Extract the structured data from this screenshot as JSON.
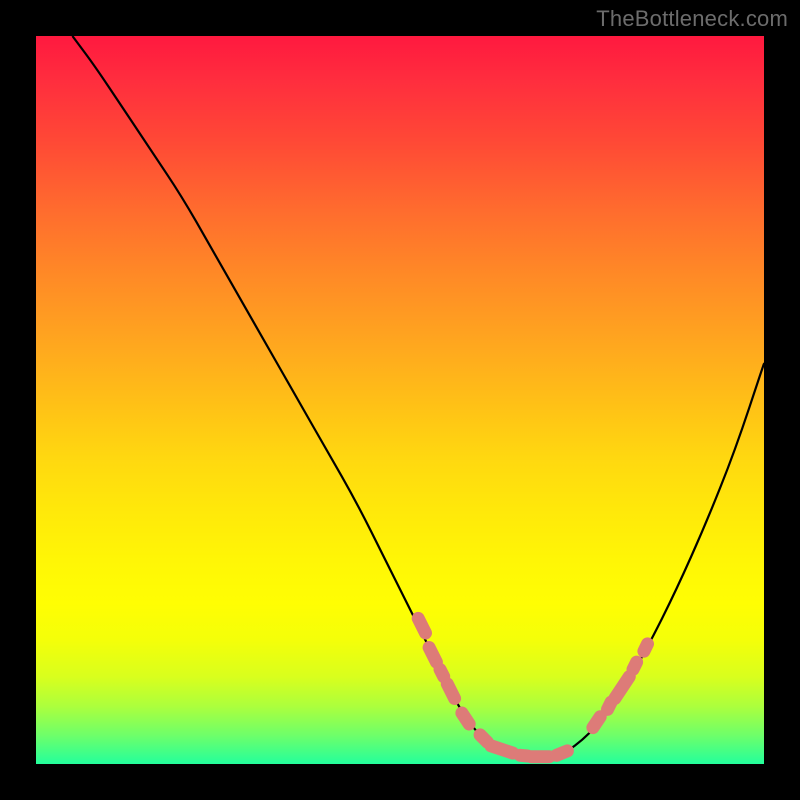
{
  "watermark": "TheBottleneck.com",
  "colors": {
    "background": "#000000",
    "gradient_top": "#ff193f",
    "gradient_bottom": "#23ff9c",
    "curve": "#000000",
    "markers": "#dd7b78",
    "watermark_text": "#6c6c6c"
  },
  "chart_data": {
    "type": "line",
    "title": "",
    "xlabel": "",
    "ylabel": "",
    "xlim": [
      0,
      100
    ],
    "ylim": [
      0,
      100
    ],
    "grid": false,
    "series": [
      {
        "name": "bottleneck_curve",
        "color": "#000000",
        "x": [
          5,
          8,
          12,
          16,
          20,
          24,
          28,
          32,
          36,
          40,
          44,
          48,
          52,
          56,
          58,
          60,
          62,
          64,
          68,
          72,
          76,
          80,
          84,
          88,
          92,
          96,
          100
        ],
        "y": [
          100,
          96,
          90,
          84,
          78,
          71,
          64,
          57,
          50,
          43,
          36,
          28,
          20,
          12,
          8,
          5,
          3,
          2,
          1,
          1,
          4,
          9,
          16,
          24,
          33,
          43,
          55
        ]
      }
    ],
    "markers": [
      {
        "name": "highlighted_segments",
        "color": "#dd7b78",
        "shape": "rounded-bar",
        "segments": [
          {
            "x0": 52.5,
            "y0": 20.0,
            "x1": 53.5,
            "y1": 18.0
          },
          {
            "x0": 54.0,
            "y0": 16.0,
            "x1": 55.0,
            "y1": 14.0
          },
          {
            "x0": 55.5,
            "y0": 13.0,
            "x1": 56.0,
            "y1": 12.0
          },
          {
            "x0": 56.5,
            "y0": 11.0,
            "x1": 57.5,
            "y1": 9.0
          },
          {
            "x0": 58.5,
            "y0": 7.0,
            "x1": 59.5,
            "y1": 5.5
          },
          {
            "x0": 61.0,
            "y0": 4.0,
            "x1": 62.0,
            "y1": 3.0
          },
          {
            "x0": 62.5,
            "y0": 2.5,
            "x1": 65.5,
            "y1": 1.5
          },
          {
            "x0": 66.5,
            "y0": 1.2,
            "x1": 67.5,
            "y1": 1.1
          },
          {
            "x0": 68.0,
            "y0": 1.0,
            "x1": 70.5,
            "y1": 1.0
          },
          {
            "x0": 71.5,
            "y0": 1.2,
            "x1": 73.0,
            "y1": 1.8
          },
          {
            "x0": 76.5,
            "y0": 5.0,
            "x1": 77.5,
            "y1": 6.5
          },
          {
            "x0": 78.5,
            "y0": 7.5,
            "x1": 79.0,
            "y1": 8.5
          },
          {
            "x0": 79.5,
            "y0": 9.0,
            "x1": 81.5,
            "y1": 12.0
          },
          {
            "x0": 82.0,
            "y0": 13.0,
            "x1": 82.5,
            "y1": 14.0
          },
          {
            "x0": 83.5,
            "y0": 15.5,
            "x1": 84.0,
            "y1": 16.5
          }
        ]
      }
    ],
    "background_gradient": {
      "direction": "vertical",
      "stops": [
        {
          "pos": 0.0,
          "color": "#ff193f"
        },
        {
          "pos": 0.5,
          "color": "#ffc216"
        },
        {
          "pos": 0.78,
          "color": "#fffe03"
        },
        {
          "pos": 1.0,
          "color": "#23ff9c"
        }
      ]
    }
  }
}
